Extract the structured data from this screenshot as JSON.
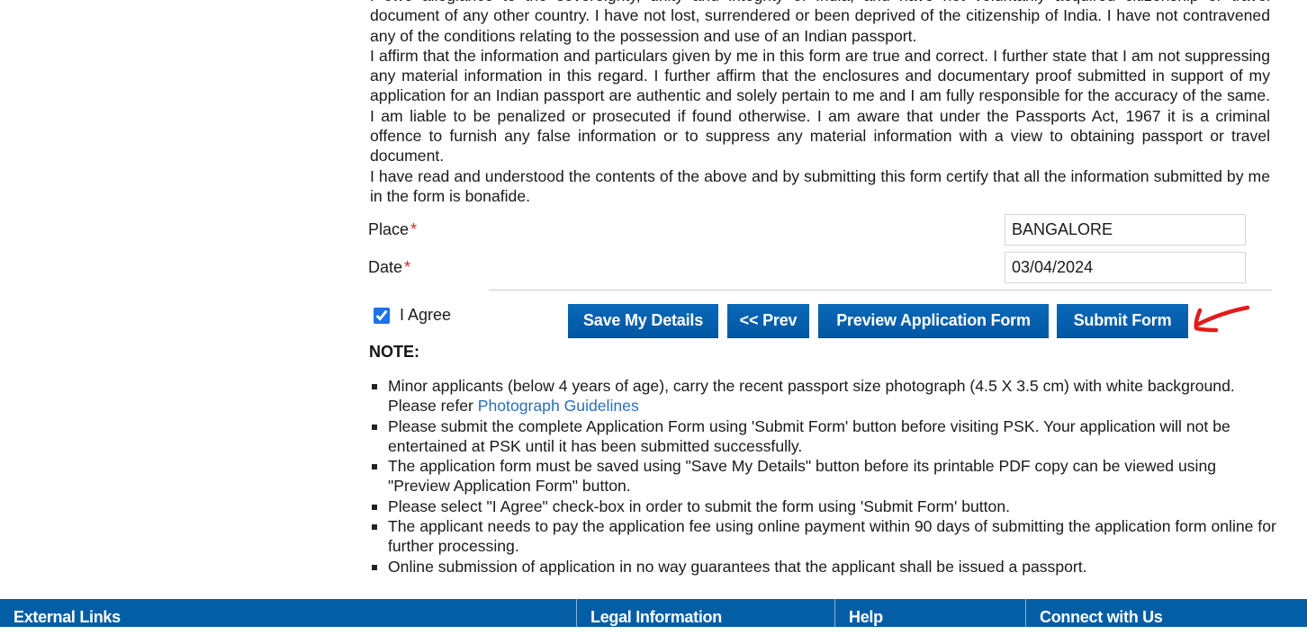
{
  "declaration": {
    "clipped_line": "I owe allegiance to the sovereignty, unity and integrity of India, and have not voluntarily acquired citizenship or travel",
    "paragraph1_tail": "document of any other country. I have not lost, surrendered or been deprived of the citizenship of India. I have not contravened any of the conditions relating to the possession and use of an Indian passport.",
    "paragraph2": "I affirm that the information and particulars given by me in this form are true and correct. I further state that I am not suppressing any material information in this regard. I further affirm that the enclosures and documentary proof submitted in support of my application for an Indian passport are authentic and solely pertain to me and I am fully responsible for the accuracy of the same. I am liable to be penalized or prosecuted if found otherwise. I am aware that under the Passports Act, 1967 it is a criminal offence to furnish any false information or to suppress any material information with a view to obtaining passport or travel document.",
    "paragraph3": "I have read and understood the contents of the above and by submitting this form certify that all the information submitted by me in the form is bonafide."
  },
  "form": {
    "place": {
      "label": "Place",
      "required_mark": "*",
      "value": "BANGALORE"
    },
    "date": {
      "label": "Date",
      "required_mark": "*",
      "value": "03/04/2024"
    },
    "agree": {
      "label": "I Agree",
      "checked": true
    }
  },
  "buttons": {
    "save": "Save My Details",
    "prev": "<< Prev",
    "preview": "Preview Application Form",
    "submit": "Submit Form"
  },
  "annotation": {
    "icon": "red-arrow-icon",
    "color": "#e21b1b"
  },
  "notes": {
    "title": "NOTE:",
    "items": [
      {
        "text": "Minor applicants (below 4 years of age), carry the recent passport size photograph (4.5 X 3.5 cm) with white background. Please refer ",
        "link": "Photograph Guidelines"
      },
      {
        "text": "Please submit the complete Application Form using 'Submit Form' button before visiting PSK. Your application will not be entertained at PSK until it has been submitted successfully."
      },
      {
        "text": "The application form must be saved using \"Save My Details\" button before its printable PDF copy can be viewed using \"Preview Application Form\" button."
      },
      {
        "text": "Please select \"I Agree\" check-box in order to submit the form using 'Submit Form' button."
      },
      {
        "text": "The applicant needs to pay the application fee using online payment within 90 days of submitting the application form online for further processing."
      },
      {
        "text": "Online submission of application in no way guarantees that the applicant shall be issued a passport."
      }
    ]
  },
  "footer": {
    "columns": [
      "External Links",
      "Legal Information",
      "Help",
      "Connect with Us"
    ],
    "background": "#035ea6"
  },
  "colors": {
    "button": "#0a63b0",
    "link": "#2a6ebb",
    "required": "#d9262b"
  }
}
